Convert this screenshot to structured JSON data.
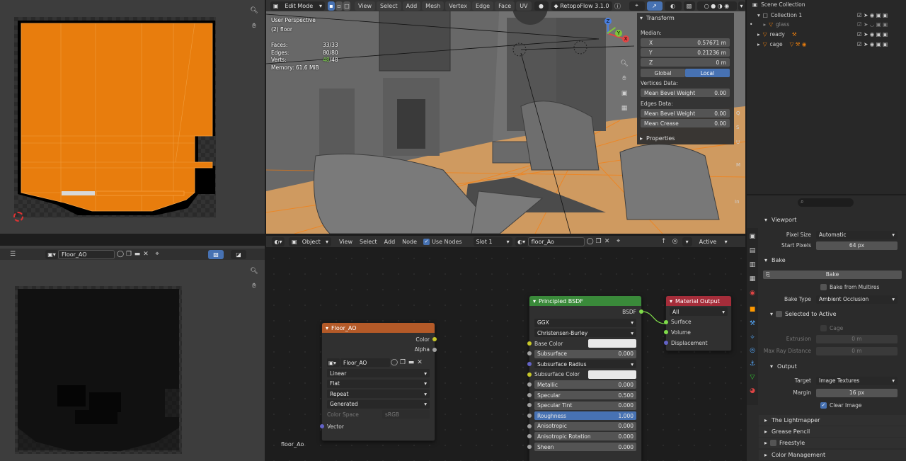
{
  "colors": {
    "accent": "#4772b3",
    "orange": "#e87d0d",
    "header": "#303030"
  },
  "uv_editor": {
    "zoom_icon": "zoom-icon",
    "hand_icon": "hand-icon"
  },
  "viewport": {
    "mode": "Edit Mode",
    "menus": [
      "View",
      "Select",
      "Add",
      "Mesh",
      "Vertex",
      "Edge",
      "Face",
      "UV"
    ],
    "addon": "RetopoFlow 3.1.0",
    "perspective": "User Perspective",
    "object": "(2) floor",
    "stats": {
      "faces_label": "Faces:",
      "faces": "33/33",
      "edges_label": "Edges:",
      "edges": "80/80",
      "verts_label": "Verts:",
      "verts_sel": "48",
      "verts_total": "/48",
      "memory": "Memory: 61.6 MiB"
    },
    "axes": {
      "x": "X",
      "y": "Y",
      "z": "Z"
    },
    "side_tabs": [
      "Q",
      "S",
      "U",
      "M",
      "In"
    ]
  },
  "transform": {
    "title": "Transform",
    "median": "Median:",
    "x_label": "X",
    "x": "0.57671 m",
    "y_label": "Y",
    "y": "0.21236 m",
    "z_label": "Z",
    "z": "0 m",
    "global": "Global",
    "local": "Local",
    "vertices_data": "Vertices Data:",
    "mean_bevel_weight": "Mean Bevel Weight",
    "v_bevel": "0.00",
    "edges_data": "Edges Data:",
    "e_bevel": "0.00",
    "mean_crease": "Mean Crease",
    "crease": "0.00",
    "properties": "Properties"
  },
  "outliner": {
    "scene": "Scene Collection",
    "items": [
      {
        "name": "Collection 1",
        "depth": 1
      },
      {
        "name": "glass",
        "depth": 2
      },
      {
        "name": "ready",
        "depth": 1
      },
      {
        "name": "cage",
        "depth": 1
      }
    ]
  },
  "image_editor": {
    "image": "Floor_AO"
  },
  "node_editor": {
    "object": "Object",
    "menus": [
      "View",
      "Select",
      "Add",
      "Node"
    ],
    "use_nodes": "Use Nodes",
    "slot": "Slot 1",
    "material": "floor_Ao",
    "active": "Active",
    "frame_label": "floor_Ao",
    "image_node": {
      "title": "Floor_AO",
      "color": "Color",
      "alpha": "Alpha",
      "image": "Floor_AO",
      "interp": "Linear",
      "proj": "Flat",
      "ext": "Repeat",
      "source": "Generated",
      "color_space": "Color Space",
      "color_space_val": "sRGB",
      "vector": "Vector"
    },
    "bsdf": {
      "title": "Principled BSDF",
      "out": "BSDF",
      "dist": "GGX",
      "sss": "Christensen-Burley",
      "rows": [
        {
          "label": "Subsurface",
          "value": "0.000"
        },
        {
          "label": "Subsurface Radius",
          "value": ""
        },
        {
          "label": "Subsurface Color",
          "value": ""
        },
        {
          "label": "Metallic",
          "value": "0.000"
        },
        {
          "label": "Specular",
          "value": "0.500"
        },
        {
          "label": "Specular Tint",
          "value": "0.000"
        },
        {
          "label": "Roughness",
          "value": "1.000"
        },
        {
          "label": "Anisotropic",
          "value": "0.000"
        },
        {
          "label": "Anisotropic Rotation",
          "value": "0.000"
        },
        {
          "label": "Sheen",
          "value": "0.000"
        }
      ],
      "base_color": "Base Color"
    },
    "output": {
      "title": "Material Output",
      "target": "All",
      "surface": "Surface",
      "volume": "Volume",
      "displacement": "Displacement"
    }
  },
  "properties": {
    "viewport": "Viewport",
    "pixel_size_label": "Pixel Size",
    "pixel_size": "Automatic",
    "start_pixels_label": "Start Pixels",
    "start_pixels": "64 px",
    "bake_section": "Bake",
    "bake_button": "Bake",
    "bake_multires": "Bake from Multires",
    "bake_type_label": "Bake Type",
    "bake_type": "Ambient Occlusion",
    "selected_to_active": "Selected to Active",
    "cage": "Cage",
    "extrusion_label": "Extrusion",
    "extrusion": "0 m",
    "max_ray_label": "Max Ray Distance",
    "max_ray": "0 m",
    "output": "Output",
    "target_label": "Target",
    "target": "Image Textures",
    "margin_label": "Margin",
    "margin": "16 px",
    "clear_image": "Clear Image",
    "lightmapper": "The Lightmapper",
    "grease_pencil": "Grease Pencil",
    "freestyle": "Freestyle",
    "color_management": "Color Management"
  }
}
